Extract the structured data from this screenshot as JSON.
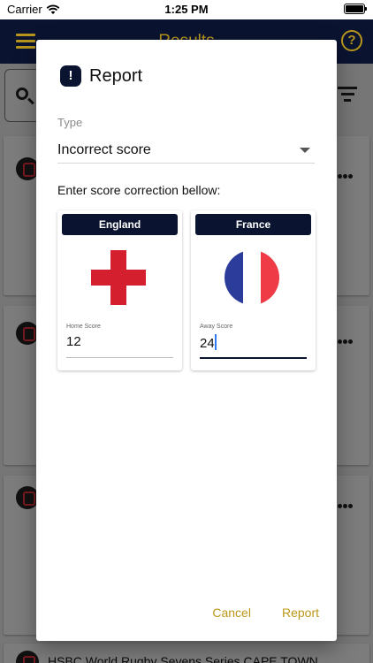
{
  "status_bar": {
    "carrier": "Carrier",
    "time": "1:25 PM"
  },
  "app_bar": {
    "title": "Results"
  },
  "background": {
    "cards_bottom_title": "HSBC World Rugby Sevens Series CAPE TOWN"
  },
  "modal": {
    "title": "Report",
    "icon": "alert-octagon-icon",
    "type_label": "Type",
    "type_value": "Incorrect score",
    "instruction": "Enter score correction bellow:",
    "home": {
      "team": "England",
      "score_label": "Home Score",
      "score": "12"
    },
    "away": {
      "team": "France",
      "score_label": "Away Score",
      "score": "24"
    },
    "cancel_label": "Cancel",
    "report_label": "Report"
  },
  "colors": {
    "navy": "#0a1330",
    "gold": "#bb9718",
    "red": "#d31f2e",
    "france_blue": "#2c3c9b",
    "france_red": "#ee3b45"
  }
}
